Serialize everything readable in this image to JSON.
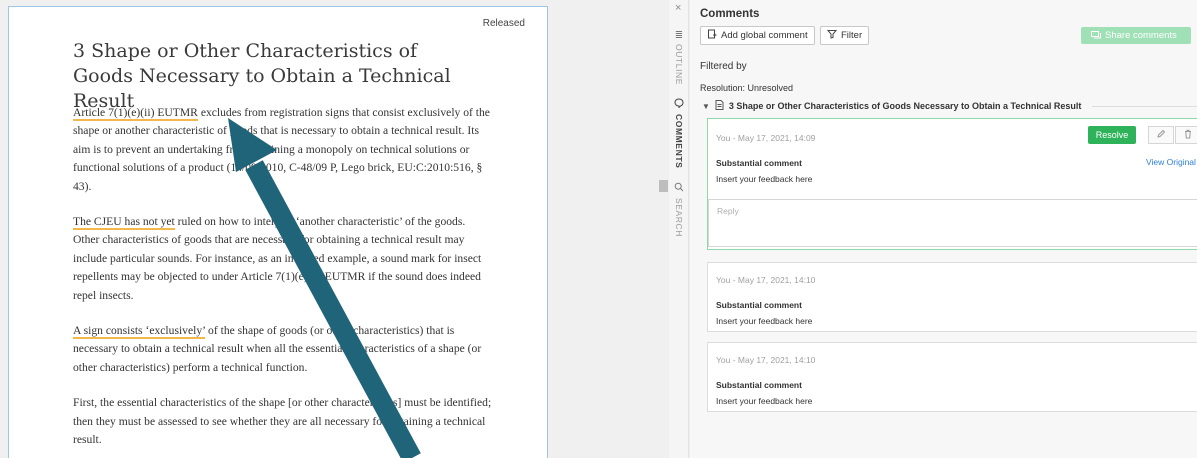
{
  "document": {
    "status": "Released",
    "title": "3 Shape or Other Characteristics of Goods Necessary to Obtain a Technical Result",
    "paragraphs": [
      {
        "highlight": "Article 7(1)(e)(ii) EUTMR",
        "rest": " excludes from registration signs that consist exclusively of the shape or another characteristic of goods that is necessary to obtain a technical result. Its aim is to prevent an undertaking from obtaining a monopoly on technical solutions or functional solutions of a product (14/09/2010, C-48/09 P, Lego brick, EU:C:2010:516, § 43)."
      },
      {
        "highlight": "The CJEU has not yet",
        "rest": " ruled on how to interpret ‘another characteristic’ of the goods. Other characteristics of goods that are necessary for obtaining a technical result may include particular sounds. For instance, as an invented example, a sound mark for insect repellents may be objected to under Article 7(1)(e)(ii) EUTMR if the sound does indeed repel insects."
      },
      {
        "highlight": "A sign consists ‘exclusively’",
        "rest": " of the shape of goods (or other characteristics) that is necessary to obtain a technical result when all the essential characteristics of a shape (or other characteristics) perform a technical function."
      },
      {
        "highlight": "",
        "rest": "First, the essential characteristics of the shape [or other characteristics] must be identified; then they must be assessed to see whether they are all necessary for obtaining a technical result."
      }
    ]
  },
  "side_tabs": {
    "close": "×",
    "outline": "OUTLINE",
    "comments": "COMMENTS",
    "search": "SEARCH"
  },
  "comments_panel": {
    "title": "Comments",
    "add_global": "Add global comment",
    "filter": "Filter",
    "share": "Share comments",
    "filtered_by": "Filtered by",
    "resolution": "Resolution: Unresolved",
    "section_title": "3 Shape or Other Characteristics of Goods Necessary to Obtain a Technical Result",
    "cards": [
      {
        "meta": "You - May 17, 2021, 14:09",
        "type": "Substantial comment",
        "text": "Insert your feedback here",
        "resolve": "Resolve",
        "view_original": "View Original",
        "reply_placeholder": "Reply"
      },
      {
        "meta": "You - May 17, 2021, 14:10",
        "type": "Substantial comment",
        "text": "Insert your feedback here"
      },
      {
        "meta": "You - May 17, 2021, 14:10",
        "type": "Substantial comment",
        "text": "Insert your feedback here"
      }
    ]
  },
  "colors": {
    "accent_green": "#2fb35a",
    "highlight_underline": "#f2b84b",
    "arrow": "#1f6478",
    "link": "#2f7ed8"
  }
}
